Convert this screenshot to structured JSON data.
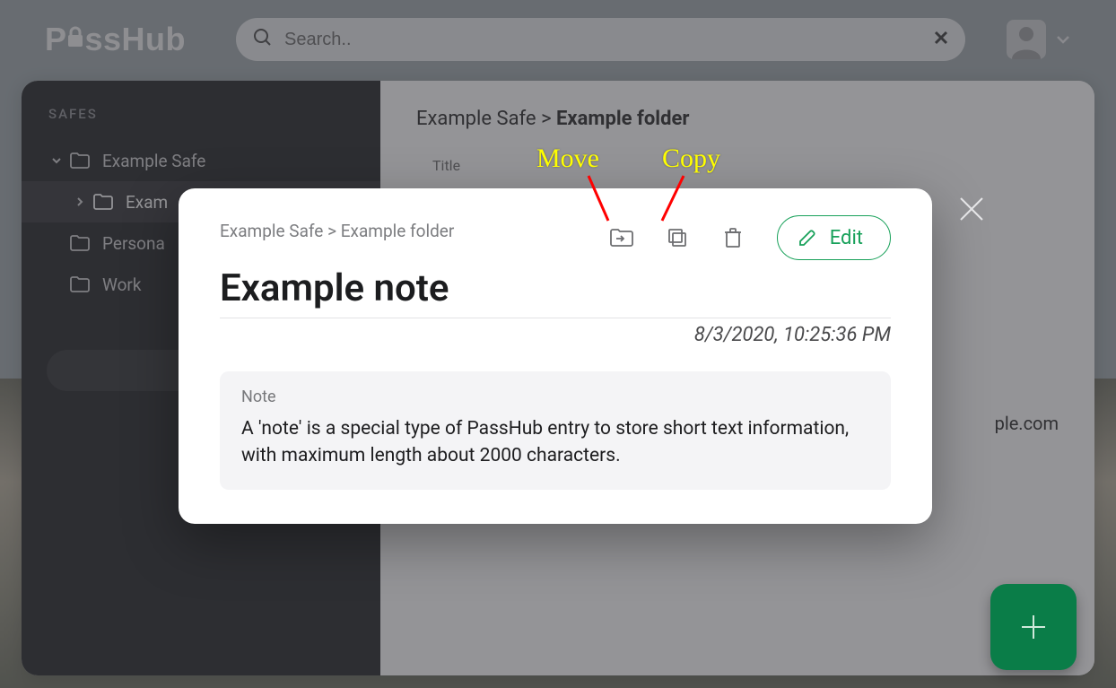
{
  "app": {
    "name": "PassHub"
  },
  "search": {
    "placeholder": "Search.."
  },
  "sidebar": {
    "heading": "SAFES",
    "items": [
      {
        "label": "Example Safe",
        "expanded": true,
        "level": 0
      },
      {
        "label": "Example folder",
        "expanded": false,
        "level": 1,
        "truncated": "Exam"
      },
      {
        "label": "Personal",
        "level": 0,
        "truncated": "Persona"
      },
      {
        "label": "Work",
        "level": 0
      }
    ],
    "add_label": "A"
  },
  "content": {
    "breadcrumb_parent": "Example Safe",
    "breadcrumb_sep": ">",
    "breadcrumb_current": "Example folder",
    "column_title": "Title",
    "partial_row_text": "ple.com"
  },
  "modal": {
    "breadcrumb": "Example Safe > Example folder",
    "edit_label": "Edit",
    "title": "Example note",
    "timestamp": "8/3/2020, 10:25:36 PM",
    "note_label": "Note",
    "note_body": "A 'note' is a special type of PassHub entry to store short text information, with maximum length about 2000 characters."
  },
  "annotations": {
    "move": "Move",
    "copy": "Copy"
  }
}
